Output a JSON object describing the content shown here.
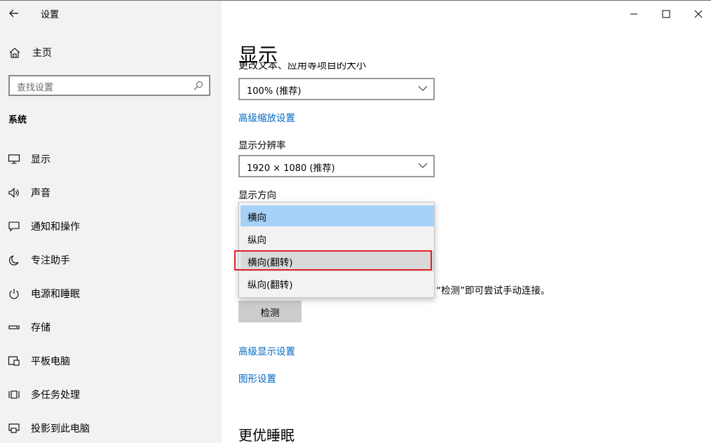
{
  "window": {
    "title": "设置",
    "minimize_icon": "minimize-icon",
    "maximize_icon": "maximize-icon",
    "close_icon": "close-icon"
  },
  "sidebar": {
    "back_icon": "back-arrow-icon",
    "home": {
      "label": "主页",
      "icon": "home-icon"
    },
    "search": {
      "placeholder": "查找设置",
      "icon": "search-icon"
    },
    "section_title": "系统",
    "items": [
      {
        "label": "显示",
        "icon": "monitor-icon"
      },
      {
        "label": "声音",
        "icon": "speaker-icon"
      },
      {
        "label": "通知和操作",
        "icon": "notification-icon"
      },
      {
        "label": "专注助手",
        "icon": "moon-icon"
      },
      {
        "label": "电源和睡眠",
        "icon": "power-icon"
      },
      {
        "label": "存储",
        "icon": "storage-icon"
      },
      {
        "label": "平板电脑",
        "icon": "tablet-icon"
      },
      {
        "label": "多任务处理",
        "icon": "multitasking-icon"
      },
      {
        "label": "投影到此电脑",
        "icon": "projection-icon"
      }
    ]
  },
  "main": {
    "title": "显示",
    "cut_label": "更改文本、应用等项目的大小",
    "scale": {
      "value": "100% (推荐)"
    },
    "advanced_scaling_link": "高级缩放设置",
    "resolution_label": "显示分辨率",
    "resolution": {
      "value": "1920 × 1080 (推荐)"
    },
    "orientation_label": "显示方向",
    "orientation_options": [
      "横向",
      "纵向",
      "横向(翻转)",
      "纵向(翻转)"
    ],
    "orientation_selected": "横向",
    "orientation_highlighted": "横向(翻转)",
    "detect_hint": "“检测”即可尝试手动连接。",
    "detect_button": "检测",
    "advanced_display_link": "高级显示设置",
    "graphics_link": "图形设置",
    "sleep_section_title": "更优睡眠"
  },
  "colors": {
    "sidebar_bg": "#f2f2f2",
    "link": "#0067c0",
    "selected_option": "#a6d2f7",
    "annotation_red": "#e0202a"
  }
}
